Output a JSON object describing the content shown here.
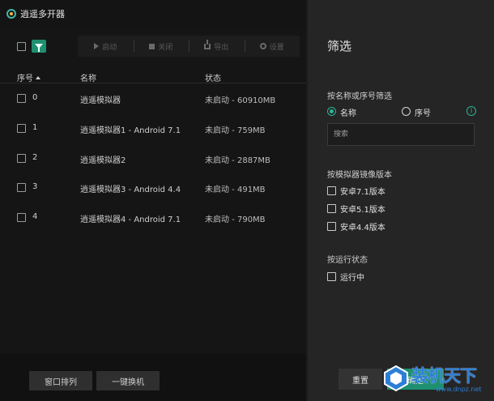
{
  "app": {
    "title": "逍遥多开器"
  },
  "toolbar": {
    "start_label": "启动",
    "close_label": "关闭",
    "export_label": "导出",
    "settings_label": "设置"
  },
  "table": {
    "columns": [
      "序号",
      "名称",
      "状态"
    ],
    "rows": [
      {
        "idx": "0",
        "name": "逍遥模拟器",
        "state": "未启动 - 60910MB"
      },
      {
        "idx": "1",
        "name": "逍遥模拟器1 - Android 7.1",
        "state": "未启动 - 759MB"
      },
      {
        "idx": "2",
        "name": "逍遥模拟器2",
        "state": "未启动 - 2887MB"
      },
      {
        "idx": "3",
        "name": "逍遥模拟器3 - Android 4.4",
        "state": "未启动 - 491MB"
      },
      {
        "idx": "4",
        "name": "逍遥模拟器4 - Android 7.1",
        "state": "未启动 - 790MB"
      }
    ]
  },
  "bottom": {
    "window_arrange": "窗口排列",
    "one_key_switch": "一键换机"
  },
  "filter": {
    "title": "筛选",
    "by_name_section": "按名称或序号筛选",
    "radio_name": "名称",
    "radio_index": "序号",
    "search_placeholder": "搜索",
    "by_image_section": "按模拟器镜像版本",
    "versions": [
      "安卓7.1版本",
      "安卓5.1版本",
      "安卓4.4版本"
    ],
    "by_state_section": "按运行状态",
    "running": "运行中",
    "reset": "重置",
    "confirm": "确定"
  },
  "watermark": {
    "text": "装机天下",
    "url": "www.dnpz.net"
  },
  "colors": {
    "accent": "#1e8f70",
    "panel_bg": "#252525",
    "app_bg": "#151515"
  }
}
